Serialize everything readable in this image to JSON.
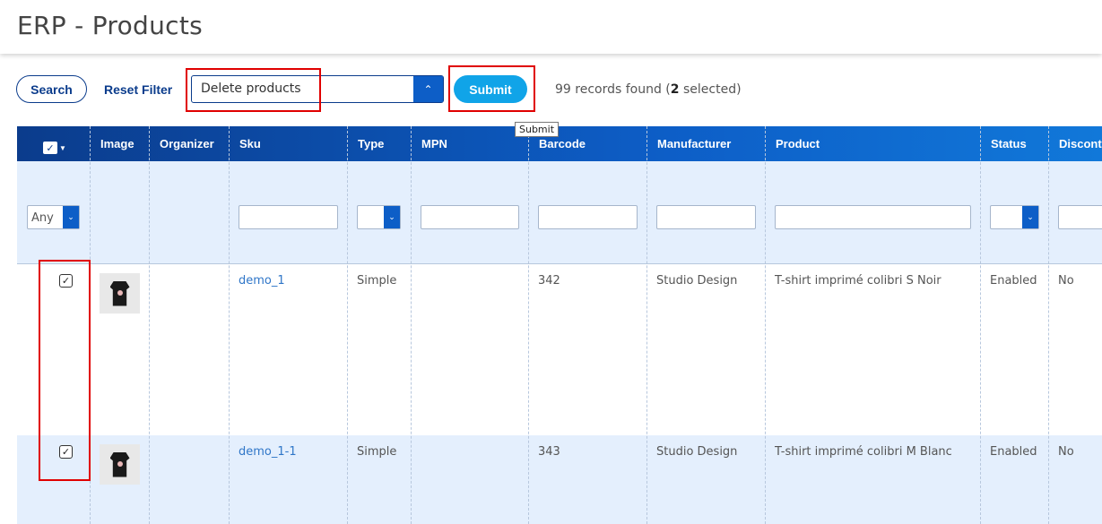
{
  "header": {
    "title": "ERP - Products"
  },
  "toolbar": {
    "search_label": "Search",
    "reset_label": "Reset Filter",
    "action_select_value": "Delete products",
    "submit_label": "Submit",
    "records_prefix": "99 records found (",
    "selected_count": "2",
    "records_suffix": " selected)"
  },
  "tooltip": {
    "text": "Submit"
  },
  "grid": {
    "columns": [
      "Image",
      "Organizer",
      "Sku",
      "Type",
      "MPN",
      "Barcode",
      "Manufacturer",
      "Product",
      "Status",
      "Discont"
    ],
    "filters": {
      "select_any": "Any"
    },
    "rows": [
      {
        "sku": "demo_1",
        "type": "Simple",
        "mpn": "",
        "barcode": "342",
        "manufacturer": "Studio Design",
        "product": "T-shirt imprimé colibri S Noir",
        "status": "Enabled",
        "discontinued": "No",
        "checked": true
      },
      {
        "sku": "demo_1-1",
        "type": "Simple",
        "mpn": "",
        "barcode": "343",
        "manufacturer": "Studio Design",
        "product": "T-shirt imprimé colibri M Blanc",
        "status": "Enabled",
        "discontinued": "No",
        "checked": true
      }
    ]
  },
  "icons": {
    "checkbox": "check-icon",
    "dropdown": "chevron-down-icon",
    "select_up": "chevron-up-icon"
  },
  "colors": {
    "header_blue": "#0b3c8c",
    "accent": "#10a4e8",
    "highlight": "#e00000",
    "row_alt": "#e4effd"
  }
}
